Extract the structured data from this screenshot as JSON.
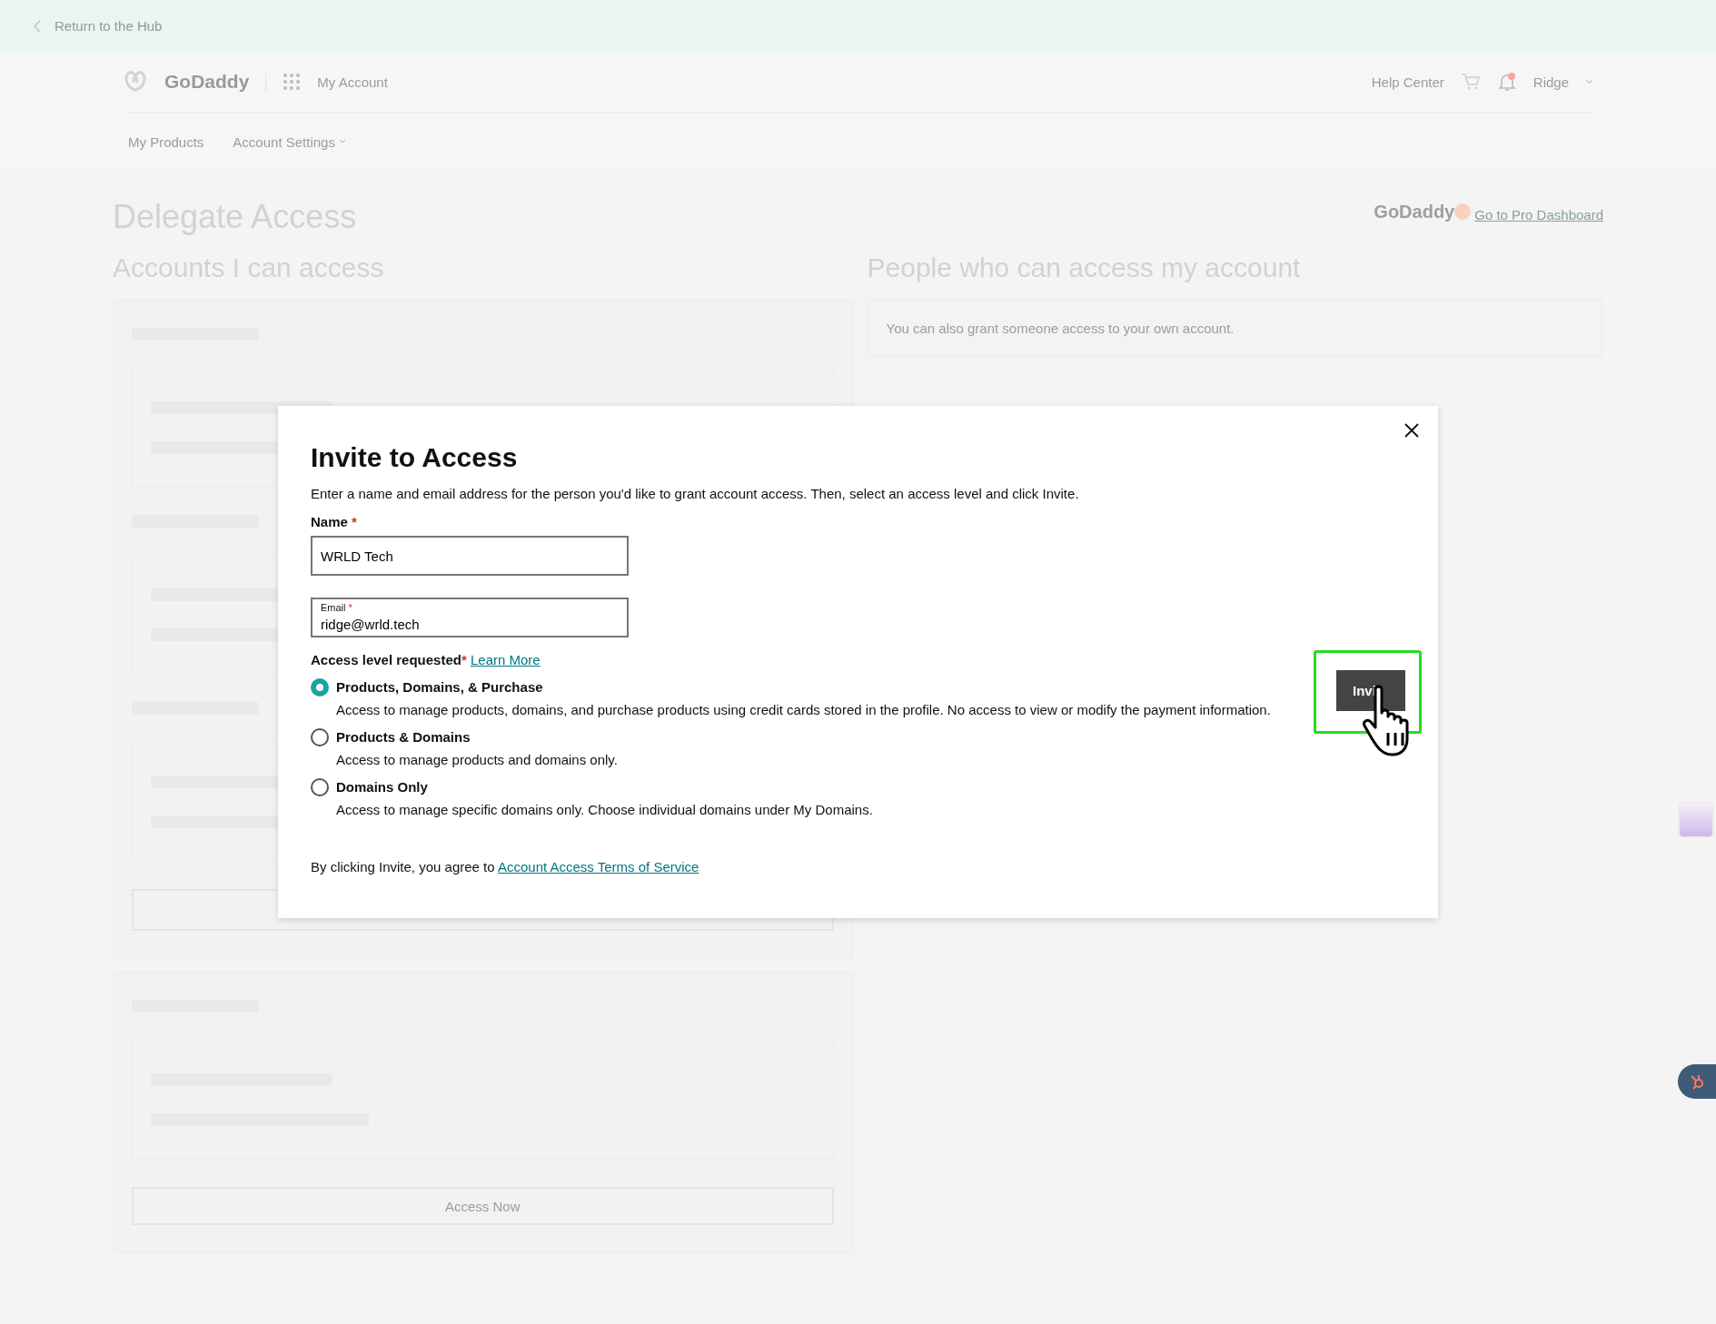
{
  "top_banner": {
    "back_link": "Return to the Hub"
  },
  "header": {
    "brand": "GoDaddy",
    "app_menu": "My Account",
    "help_link": "Help Center",
    "user": "Ridge"
  },
  "nav": [
    {
      "label": "My Products",
      "dropdown": false
    },
    {
      "label": "Account Settings",
      "dropdown": true
    }
  ],
  "page": {
    "title": "Delegate Access",
    "pro_brand": "GoDaddy",
    "pro_link": "Go to Pro Dashboard"
  },
  "left_section": {
    "title": "Accounts I can access",
    "access_button": "Access Now"
  },
  "right_section": {
    "title": "People who can access my account",
    "note": "You can also grant someone access to your own account."
  },
  "dialog": {
    "title": "Invite to Access",
    "description": "Enter a name and email address for the person you'd like to grant account access. Then, select an access level and click Invite.",
    "name_label": "Name",
    "name_required": "*",
    "email_required": "*",
    "access_required": "*",
    "name_value": "WRLD Tech",
    "email_label": "Email",
    "email_value": "ridge@wrld.tech",
    "access_label": "Access level requested",
    "learn_more": "Learn More",
    "access_levels": [
      {
        "label": "Products, Domains, & Purchase",
        "description": "Access to manage products, domains, and purchase products using credit cards stored in the profile. No access to view or modify the payment information.",
        "selected": true
      },
      {
        "label": "Products & Domains",
        "description": "Access to manage products and domains only.",
        "selected": false
      },
      {
        "label": "Domains Only",
        "description": "Access to manage specific domains only. Choose individual domains under My Domains.",
        "selected": false
      }
    ],
    "terms_text": "By clicking Invite, you agree to",
    "terms_link": "Account Access Terms of Service",
    "invite_button": "Invi"
  }
}
